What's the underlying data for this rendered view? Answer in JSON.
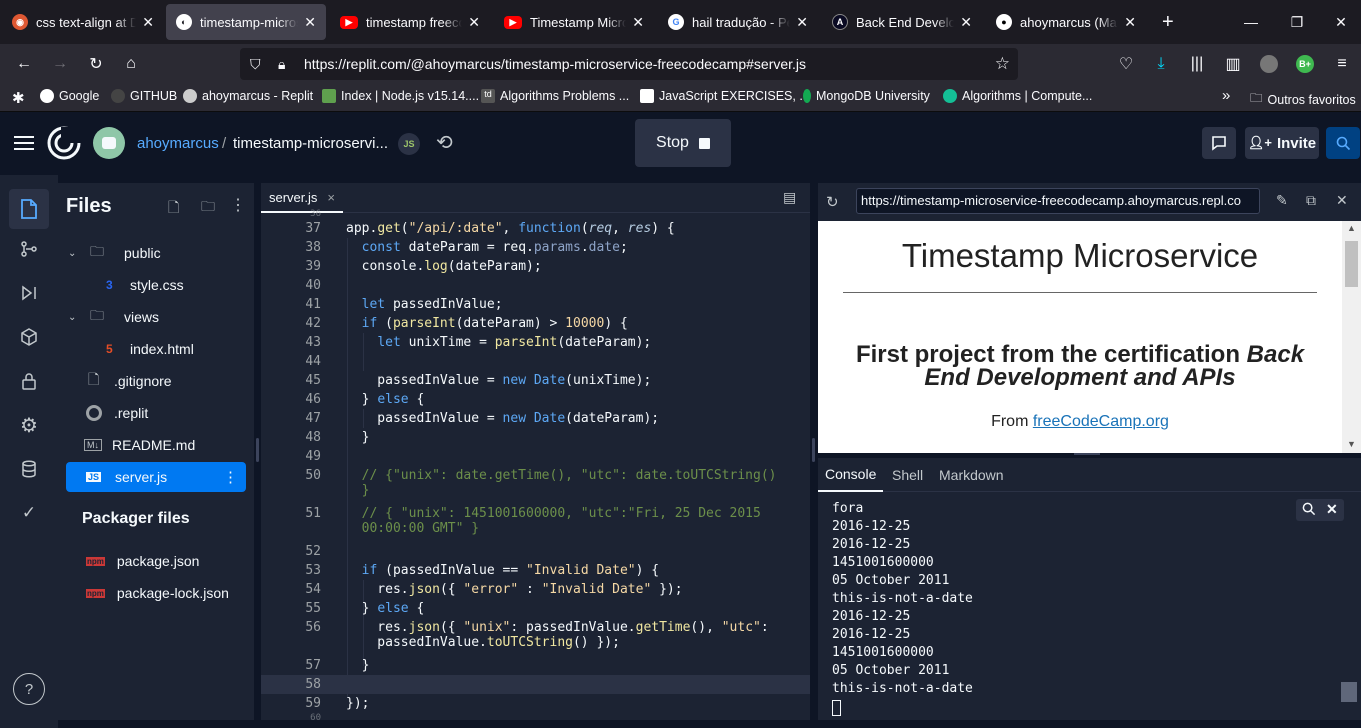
{
  "browser": {
    "tabs": [
      {
        "title": "css text-align at Duc",
        "icon": "duckduckgo-icon"
      },
      {
        "title": "timestamp-microservice",
        "icon": "replit-icon",
        "active": true
      },
      {
        "title": "timestamp freecodecamp",
        "icon": "youtube-icon"
      },
      {
        "title": "Timestamp Microservice",
        "icon": "youtube-icon"
      },
      {
        "title": "hail tradução - Pesquisa",
        "icon": "google-icon"
      },
      {
        "title": "Back End Development",
        "icon": "freecodecamp-icon"
      },
      {
        "title": "ahoymarcus (Marcus)",
        "icon": "github-icon"
      }
    ],
    "url": "https://replit.com/@ahoymarcus/timestamp-microservice-freecodecamp#server.js",
    "profile_badge": "B+",
    "bookmarks": [
      {
        "label": "Google"
      },
      {
        "label": "GITHUB"
      },
      {
        "label": "ahoymarcus - Replit"
      },
      {
        "label": "Index | Node.js v15.14...."
      },
      {
        "label": "Algorithms Problems ..."
      },
      {
        "label": "JavaScript EXERCISES, ..."
      },
      {
        "label": "MongoDB University"
      },
      {
        "label": "Algorithms | Compute..."
      }
    ],
    "other_bookmarks": "Outros favoritos",
    "overflow": "»"
  },
  "replit": {
    "username": "ahoymarcus",
    "separator": "/",
    "repl_name": "timestamp-microservi...",
    "stop_label": "Stop",
    "invite_label": "Invite",
    "help_label": "?"
  },
  "files_panel": {
    "title": "Files",
    "items": [
      {
        "name": "public",
        "kind": "folder"
      },
      {
        "name": "style.css",
        "kind": "css"
      },
      {
        "name": "views",
        "kind": "folder"
      },
      {
        "name": "index.html",
        "kind": "html"
      },
      {
        "name": ".gitignore",
        "kind": "file"
      },
      {
        "name": ".replit",
        "kind": "replit"
      },
      {
        "name": "README.md",
        "kind": "md"
      },
      {
        "name": "server.js",
        "kind": "js",
        "selected": true
      }
    ],
    "packager_title": "Packager files",
    "packager_items": [
      {
        "name": "package.json"
      },
      {
        "name": "package-lock.json"
      }
    ],
    "md_badge": "M↓",
    "js_badge": "JS",
    "npm_badge": "npm"
  },
  "editor": {
    "tab_label": "server.js",
    "tab_close": "×",
    "line_numbers": [
      "37",
      "38",
      "39",
      "40",
      "41",
      "42",
      "43",
      "44",
      "45",
      "46",
      "47",
      "48",
      "49",
      "50",
      "51",
      "52",
      "53",
      "54",
      "55",
      "56",
      "57",
      "58",
      "59"
    ],
    "folded_top": "36",
    "folded_bottom": "60"
  },
  "webview": {
    "url": "https://timestamp-microservice-freecodecamp.ahoymarcus.repl.co",
    "heading": "Timestamp Microservice",
    "subheading_plain": "First project from the certification ",
    "subheading_em": "Back End Development and APIs",
    "from_label": "From ",
    "from_link": "freeCodeCamp.org"
  },
  "console": {
    "tabs": [
      "Console",
      "Shell",
      "Markdown"
    ],
    "lines": [
      "fora",
      "2016-12-25",
      "2016-12-25",
      "1451001600000",
      "05 October 2011",
      "this-is-not-a-date",
      "2016-12-25",
      "2016-12-25",
      "1451001600000",
      "05 October 2011",
      "this-is-not-a-date"
    ]
  },
  "colors": {
    "accent": "#0079f2",
    "bg": "#0e1525",
    "panel": "#1c2333"
  }
}
